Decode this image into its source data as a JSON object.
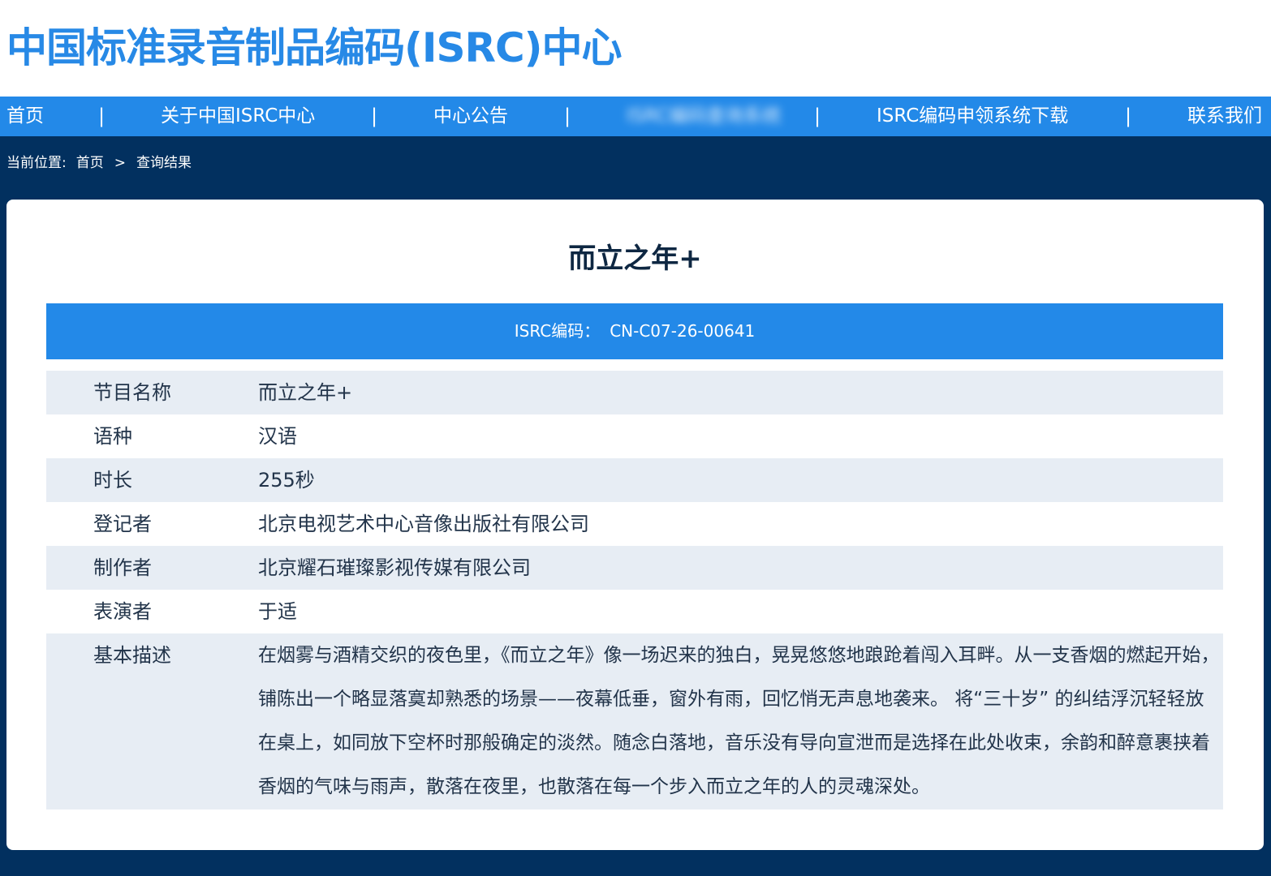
{
  "site": {
    "title": "中国标准录音制品编码(ISRC)中心"
  },
  "nav": {
    "items": [
      "首页",
      "关于中国ISRC中心",
      "中心公告",
      "ISRC编码查询系统",
      "ISRC编码申领系统下载",
      "联系我们"
    ],
    "separator": "|"
  },
  "breadcrumb": {
    "prefix": "当前位置:",
    "home": "首页",
    "arrow": ">",
    "current": "查询结果"
  },
  "record": {
    "title": "而立之年+",
    "isrc_label": "ISRC编码：",
    "isrc_code": "CN-C07-26-00641",
    "fields": [
      {
        "label": "节目名称",
        "value": "而立之年+"
      },
      {
        "label": "语种",
        "value": "汉语"
      },
      {
        "label": "时长",
        "value": "255秒"
      },
      {
        "label": "登记者",
        "value": "北京电视艺术中心音像出版社有限公司"
      },
      {
        "label": "制作者",
        "value": "北京耀石璀璨影视传媒有限公司"
      },
      {
        "label": "表演者",
        "value": "于适"
      }
    ],
    "description_label": "基本描述",
    "description": "在烟雾与酒精交织的夜色里，《而立之年》像一场迟来的独白，晃晃悠悠地踉跄着闯入耳畔。从一支香烟的燃起开始，铺陈出一个略显落寞却熟悉的场景——夜幕低垂，窗外有雨，回忆悄无声息地袭来。 将“三十岁” 的纠结浮沉轻轻放在桌上，如同放下空杯时那般确定的淡然。随念白落地，音乐没有导向宣泄而是选择在此处收束，余韵和醉意裹挟着香烟的气味与雨声，散落在夜里，也散落在每一个步入而立之年的人的灵魂深处。"
  },
  "colors": {
    "brand_blue": "#2389e8",
    "page_navy": "#02305f",
    "row_alt": "#e7edf4",
    "text_dark": "#22344a"
  }
}
